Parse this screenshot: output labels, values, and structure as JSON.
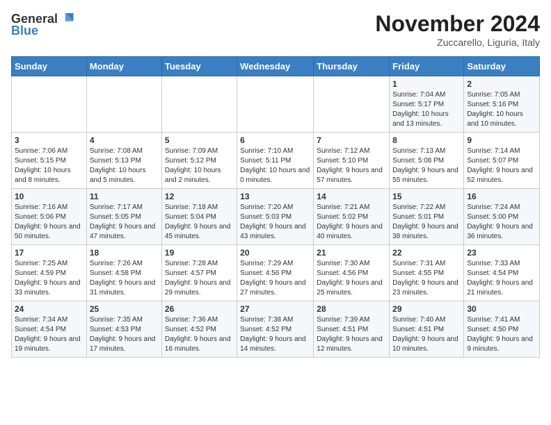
{
  "logo": {
    "general": "General",
    "blue": "Blue"
  },
  "header": {
    "month": "November 2024",
    "location": "Zuccarello, Liguria, Italy"
  },
  "days_of_week": [
    "Sunday",
    "Monday",
    "Tuesday",
    "Wednesday",
    "Thursday",
    "Friday",
    "Saturday"
  ],
  "weeks": [
    [
      {
        "day": "",
        "info": ""
      },
      {
        "day": "",
        "info": ""
      },
      {
        "day": "",
        "info": ""
      },
      {
        "day": "",
        "info": ""
      },
      {
        "day": "",
        "info": ""
      },
      {
        "day": "1",
        "info": "Sunrise: 7:04 AM\nSunset: 5:17 PM\nDaylight: 10 hours and 13 minutes."
      },
      {
        "day": "2",
        "info": "Sunrise: 7:05 AM\nSunset: 5:16 PM\nDaylight: 10 hours and 10 minutes."
      }
    ],
    [
      {
        "day": "3",
        "info": "Sunrise: 7:06 AM\nSunset: 5:15 PM\nDaylight: 10 hours and 8 minutes."
      },
      {
        "day": "4",
        "info": "Sunrise: 7:08 AM\nSunset: 5:13 PM\nDaylight: 10 hours and 5 minutes."
      },
      {
        "day": "5",
        "info": "Sunrise: 7:09 AM\nSunset: 5:12 PM\nDaylight: 10 hours and 2 minutes."
      },
      {
        "day": "6",
        "info": "Sunrise: 7:10 AM\nSunset: 5:11 PM\nDaylight: 10 hours and 0 minutes."
      },
      {
        "day": "7",
        "info": "Sunrise: 7:12 AM\nSunset: 5:10 PM\nDaylight: 9 hours and 57 minutes."
      },
      {
        "day": "8",
        "info": "Sunrise: 7:13 AM\nSunset: 5:08 PM\nDaylight: 9 hours and 55 minutes."
      },
      {
        "day": "9",
        "info": "Sunrise: 7:14 AM\nSunset: 5:07 PM\nDaylight: 9 hours and 52 minutes."
      }
    ],
    [
      {
        "day": "10",
        "info": "Sunrise: 7:16 AM\nSunset: 5:06 PM\nDaylight: 9 hours and 50 minutes."
      },
      {
        "day": "11",
        "info": "Sunrise: 7:17 AM\nSunset: 5:05 PM\nDaylight: 9 hours and 47 minutes."
      },
      {
        "day": "12",
        "info": "Sunrise: 7:18 AM\nSunset: 5:04 PM\nDaylight: 9 hours and 45 minutes."
      },
      {
        "day": "13",
        "info": "Sunrise: 7:20 AM\nSunset: 5:03 PM\nDaylight: 9 hours and 43 minutes."
      },
      {
        "day": "14",
        "info": "Sunrise: 7:21 AM\nSunset: 5:02 PM\nDaylight: 9 hours and 40 minutes."
      },
      {
        "day": "15",
        "info": "Sunrise: 7:22 AM\nSunset: 5:01 PM\nDaylight: 9 hours and 38 minutes."
      },
      {
        "day": "16",
        "info": "Sunrise: 7:24 AM\nSunset: 5:00 PM\nDaylight: 9 hours and 36 minutes."
      }
    ],
    [
      {
        "day": "17",
        "info": "Sunrise: 7:25 AM\nSunset: 4:59 PM\nDaylight: 9 hours and 33 minutes."
      },
      {
        "day": "18",
        "info": "Sunrise: 7:26 AM\nSunset: 4:58 PM\nDaylight: 9 hours and 31 minutes."
      },
      {
        "day": "19",
        "info": "Sunrise: 7:28 AM\nSunset: 4:57 PM\nDaylight: 9 hours and 29 minutes."
      },
      {
        "day": "20",
        "info": "Sunrise: 7:29 AM\nSunset: 4:56 PM\nDaylight: 9 hours and 27 minutes."
      },
      {
        "day": "21",
        "info": "Sunrise: 7:30 AM\nSunset: 4:56 PM\nDaylight: 9 hours and 25 minutes."
      },
      {
        "day": "22",
        "info": "Sunrise: 7:31 AM\nSunset: 4:55 PM\nDaylight: 9 hours and 23 minutes."
      },
      {
        "day": "23",
        "info": "Sunrise: 7:33 AM\nSunset: 4:54 PM\nDaylight: 9 hours and 21 minutes."
      }
    ],
    [
      {
        "day": "24",
        "info": "Sunrise: 7:34 AM\nSunset: 4:54 PM\nDaylight: 9 hours and 19 minutes."
      },
      {
        "day": "25",
        "info": "Sunrise: 7:35 AM\nSunset: 4:53 PM\nDaylight: 9 hours and 17 minutes."
      },
      {
        "day": "26",
        "info": "Sunrise: 7:36 AM\nSunset: 4:52 PM\nDaylight: 9 hours and 16 minutes."
      },
      {
        "day": "27",
        "info": "Sunrise: 7:38 AM\nSunset: 4:52 PM\nDaylight: 9 hours and 14 minutes."
      },
      {
        "day": "28",
        "info": "Sunrise: 7:39 AM\nSunset: 4:51 PM\nDaylight: 9 hours and 12 minutes."
      },
      {
        "day": "29",
        "info": "Sunrise: 7:40 AM\nSunset: 4:51 PM\nDaylight: 9 hours and 10 minutes."
      },
      {
        "day": "30",
        "info": "Sunrise: 7:41 AM\nSunset: 4:50 PM\nDaylight: 9 hours and 9 minutes."
      }
    ]
  ]
}
